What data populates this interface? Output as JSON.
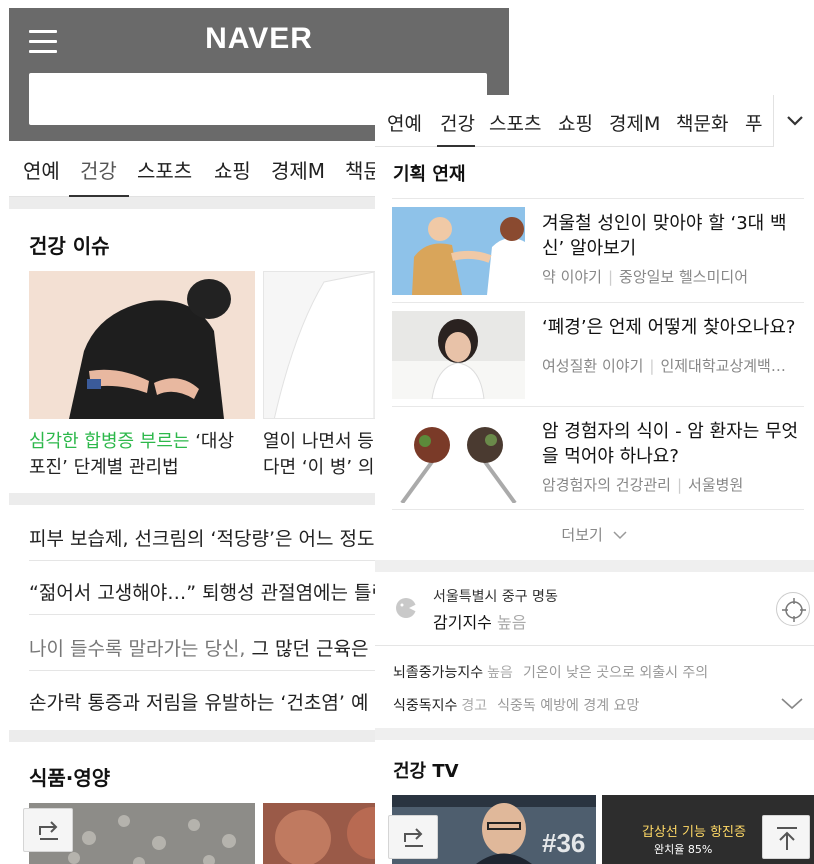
{
  "left": {
    "logo": "NAVER",
    "nav": [
      "연예",
      "건강",
      "스포츠",
      "쇼핑",
      "경제M",
      "책문"
    ],
    "issue_title": "건강 이슈",
    "card1_caption_green": "심각한 합병증 부르는",
    "card1_caption_rest": " ‘대상",
    "card1_caption_line2": "포진’ 단계별 관리법",
    "card2_caption_line1": "열이 나면서 등",
    "card2_caption_line2": "다면 ‘이 병’ 의심",
    "rows": [
      "피부 보습제, 선크림의 ‘적당량’은 어느 정도",
      "“젊어서 고생해야…” 퇴행성 관절염에는 틀린",
      "나이 들수록 말라가는 당신, 그 많던 근육은",
      "손가락 통증과 저림을 유발하는 ‘건초염’ 예"
    ],
    "row3_gray": "나이 들수록 말라가는 당신,",
    "row3_dark": " 그 많던 근육은",
    "food_title": "식품·영양"
  },
  "right": {
    "nav": [
      "연예",
      "건강",
      "스포츠",
      "쇼핑",
      "경제M",
      "책문화",
      "푸"
    ],
    "series_title": "기획 연재",
    "articles": [
      {
        "title": "겨울철 성인이 맞아야 할 ‘3대 백신’ 알아보기",
        "category": "약 이야기",
        "source": "중앙일보 헬스미디어"
      },
      {
        "title": "‘폐경’은 언제 어떻게 찾아오나요?",
        "category": "여성질환 이야기",
        "source": "인제대학교상계백…"
      },
      {
        "title": "암 경험자의 식이 - 암 환자는 무엇을 먹어야 하나요?",
        "category": "암경험자의 건강관리",
        "source": "서울병원"
      }
    ],
    "more_label": "더보기",
    "location": "서울특별시 중구 명동",
    "cold_label": "감기지수",
    "cold_level": "높음",
    "indices": [
      {
        "label": "뇌졸중가능지수",
        "level": "높음",
        "desc": "기온이 낮은 곳으로 외출시 주의"
      },
      {
        "label": "식중독지수",
        "level": "경고",
        "desc": "식중독 예방에 경계 요망"
      }
    ],
    "tv_title": "건강 TV",
    "tv1_badge": "#36",
    "tv2_text1": "갑상선 기능 항진증",
    "tv2_text2": "완치율 85%"
  },
  "colors": {
    "accent_green": "#2db84b",
    "header_gray": "#6a6a6a"
  },
  "icons": [
    "hamburger-icon",
    "share-icon",
    "chevron-down-icon",
    "location-target-icon",
    "scroll-top-icon"
  ]
}
